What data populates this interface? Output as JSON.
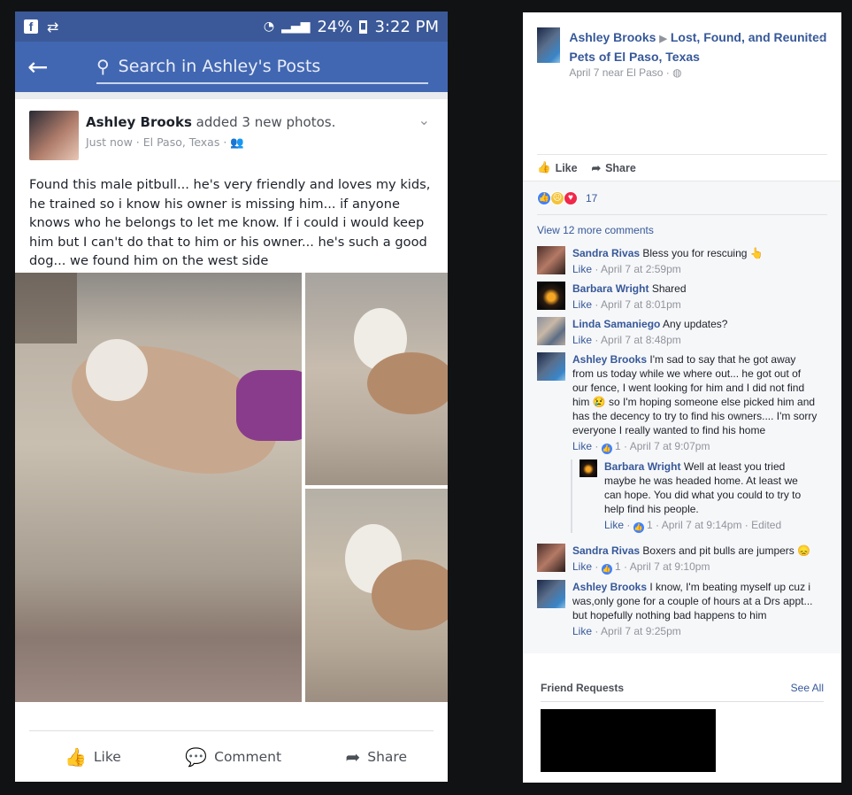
{
  "phone": {
    "status": {
      "battery": "24%",
      "time": "3:22 PM"
    },
    "search": {
      "back_icon": "arrow-left-icon",
      "placeholder": "Search in Ashley's Posts"
    },
    "post": {
      "author": "Ashley Brooks",
      "action": "added 3 new photos.",
      "time": "Just now",
      "location": "El Paso, Texas",
      "text": "Found this male pitbull... he's very friendly and loves my kids, he trained so i know his owner is missing him... if anyone knows who he belongs to let me know. If i could i would keep him but I can't do that to him or his owner... he's such a good dog... we found him on the west side",
      "actions": {
        "like": "Like",
        "comment": "Comment",
        "share": "Share"
      }
    }
  },
  "desktop": {
    "post": {
      "author": "Ashley Brooks",
      "group": "Lost, Found, and Reunited Pets of El Paso, Texas",
      "meta": "April 7 near El Paso ·",
      "actions": {
        "like": "Like",
        "share": "Share"
      },
      "reaction_count": "17",
      "more_comments": "View 12 more comments"
    },
    "comments": [
      {
        "name": "Sandra Rivas",
        "text": "Bless you for rescuing 👆",
        "like": "Like",
        "likes": "",
        "time": "April 7 at 2:59pm"
      },
      {
        "name": "Barbara Wright",
        "text": "Shared",
        "like": "Like",
        "likes": "",
        "time": "April 7 at 8:01pm"
      },
      {
        "name": "Linda Samaniego",
        "text": "Any updates?",
        "like": "Like",
        "likes": "",
        "time": "April 7 at 8:48pm"
      },
      {
        "name": "Ashley Brooks",
        "text": "I'm sad to say that he got away from us today while we where out... he got out of our fence, I went looking for him and I did not find him 😢 so I'm hoping someone else picked him and has the decency to try to find his owners.... I'm sorry everyone I really wanted to find his home",
        "like": "Like",
        "likes": "1",
        "time": "April 7 at 9:07pm"
      }
    ],
    "reply": {
      "name": "Barbara Wright",
      "text": "Well at least you tried maybe he was headed home. At least we can hope. You did what you could to try to help find his people.",
      "like": "Like",
      "likes": "1",
      "time": "April 7 at 9:14pm · Edited"
    },
    "comments2": [
      {
        "name": "Sandra Rivas",
        "text": "Boxers and pit bulls are jumpers 😞",
        "like": "Like",
        "likes": "1",
        "time": "April 7 at 9:10pm"
      },
      {
        "name": "Ashley Brooks",
        "text": "I know, I'm beating myself up cuz i was,only gone for a couple of hours at a Drs appt... but hopefully nothing bad happens to him",
        "like": "Like",
        "likes": "",
        "time": "April 7 at 9:25pm"
      }
    ],
    "friend_requests": {
      "title": "Friend Requests",
      "see_all": "See All"
    }
  }
}
